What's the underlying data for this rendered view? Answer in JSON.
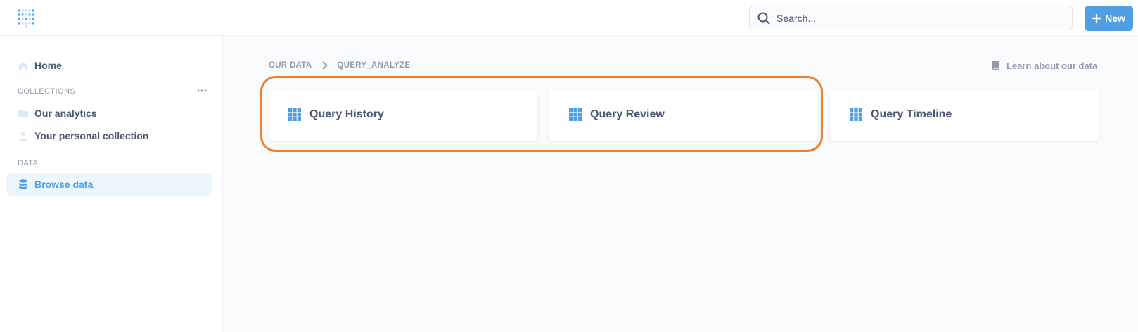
{
  "topbar": {
    "search_placeholder": "Search...",
    "new_label": "New"
  },
  "sidebar": {
    "home_label": "Home",
    "collections_heading": "COLLECTIONS",
    "our_analytics_label": "Our analytics",
    "personal_collection_label": "Your personal collection",
    "data_heading": "DATA",
    "browse_data_label": "Browse data"
  },
  "main": {
    "breadcrumb": [
      "OUR DATA",
      "QUERY_ANALYZE"
    ],
    "learn_link": "Learn about our data",
    "tables": [
      {
        "label": "Query History"
      },
      {
        "label": "Query Review"
      },
      {
        "label": "Query Timeline"
      }
    ]
  },
  "colors": {
    "brand": "#509ee3",
    "highlight": "#f07f2e",
    "text": "#4c5773",
    "muted": "#949aab"
  }
}
